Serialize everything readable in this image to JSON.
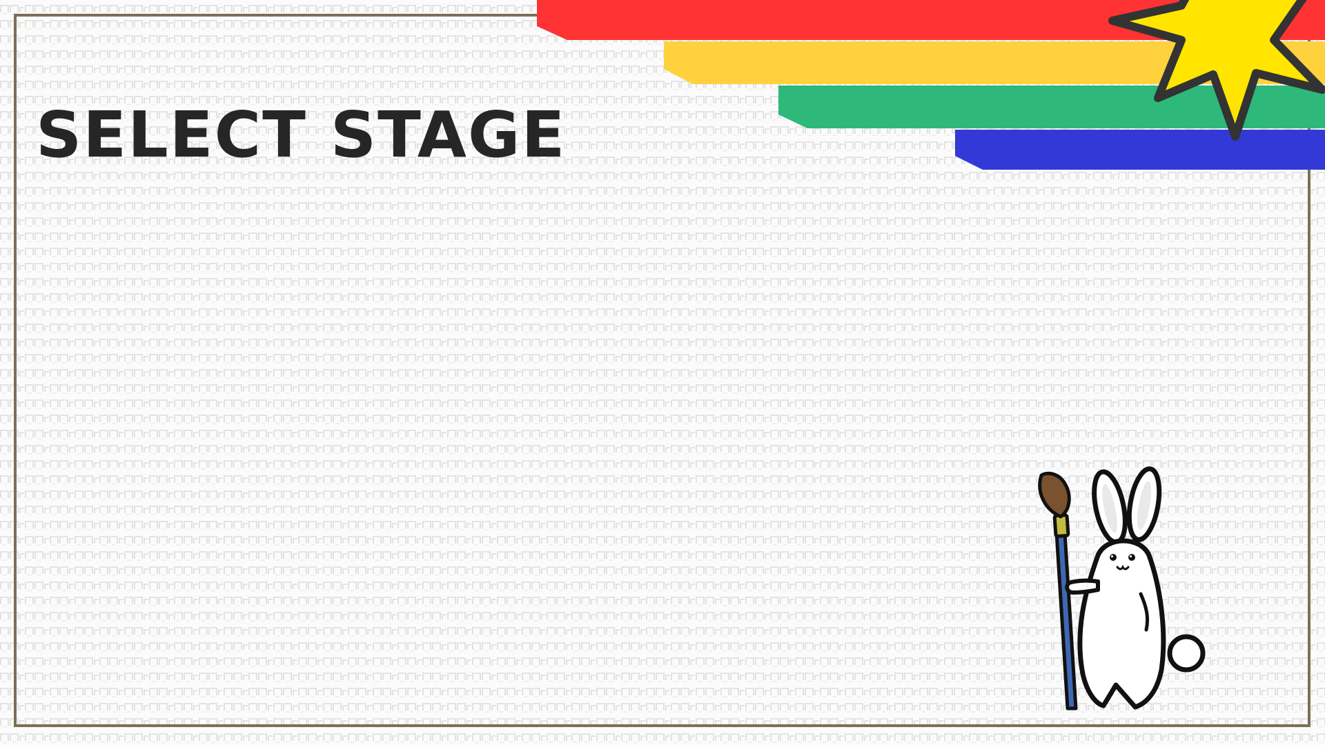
{
  "screen": {
    "title": "SELECT STAGE"
  },
  "colors": {
    "background": "#fbfbfb",
    "pattern": "#dcdcdc",
    "frame": "#7d6e57",
    "title": "#262626",
    "stripe_red": "#ff3333",
    "stripe_yellow": "#ffd23d",
    "stripe_green": "#2eb87a",
    "stripe_blue": "#3339d6",
    "star": "#ffe500",
    "star_outline": "#333333",
    "brush_handle": "#3f68b4",
    "brush_ferrule": "#c2bc3e",
    "brush_tip": "#7a5230"
  },
  "decor": {
    "stripes": [
      "red",
      "yellow",
      "green",
      "blue"
    ],
    "star_icon": "star-icon"
  },
  "mascot": {
    "character": "rabbit-holding-paintbrush"
  }
}
